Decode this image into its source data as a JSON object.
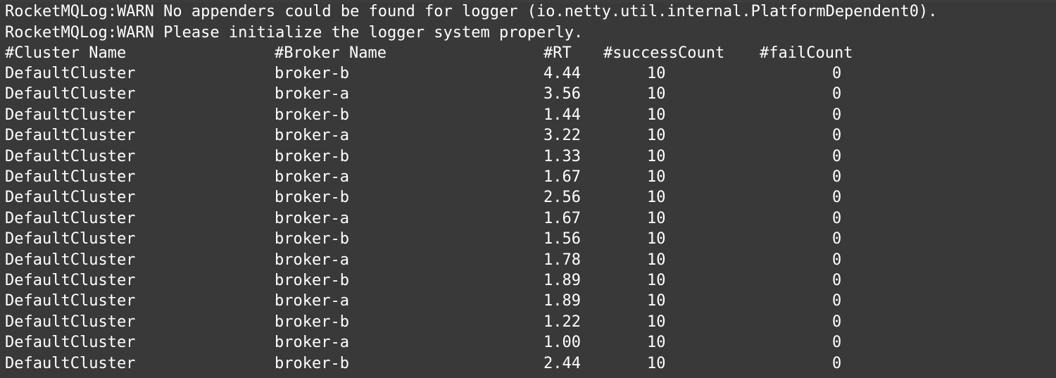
{
  "terminal": {
    "warnings": [
      "RocketMQLog:WARN No appenders could be found for logger (io.netty.util.internal.PlatformDependent0).",
      "RocketMQLog:WARN Please initialize the logger system properly."
    ],
    "headers": {
      "cluster": "#Cluster Name",
      "broker": "#Broker Name",
      "rt": "#RT",
      "success": "#successCount",
      "fail": "#failCount"
    },
    "rows": [
      {
        "cluster": "DefaultCluster",
        "broker": "broker-b",
        "rt": "4.44",
        "success": "10",
        "fail": "0"
      },
      {
        "cluster": "DefaultCluster",
        "broker": "broker-a",
        "rt": "3.56",
        "success": "10",
        "fail": "0"
      },
      {
        "cluster": "DefaultCluster",
        "broker": "broker-b",
        "rt": "1.44",
        "success": "10",
        "fail": "0"
      },
      {
        "cluster": "DefaultCluster",
        "broker": "broker-a",
        "rt": "3.22",
        "success": "10",
        "fail": "0"
      },
      {
        "cluster": "DefaultCluster",
        "broker": "broker-b",
        "rt": "1.33",
        "success": "10",
        "fail": "0"
      },
      {
        "cluster": "DefaultCluster",
        "broker": "broker-a",
        "rt": "1.67",
        "success": "10",
        "fail": "0"
      },
      {
        "cluster": "DefaultCluster",
        "broker": "broker-b",
        "rt": "2.56",
        "success": "10",
        "fail": "0"
      },
      {
        "cluster": "DefaultCluster",
        "broker": "broker-a",
        "rt": "1.67",
        "success": "10",
        "fail": "0"
      },
      {
        "cluster": "DefaultCluster",
        "broker": "broker-b",
        "rt": "1.56",
        "success": "10",
        "fail": "0"
      },
      {
        "cluster": "DefaultCluster",
        "broker": "broker-a",
        "rt": "1.78",
        "success": "10",
        "fail": "0"
      },
      {
        "cluster": "DefaultCluster",
        "broker": "broker-b",
        "rt": "1.89",
        "success": "10",
        "fail": "0"
      },
      {
        "cluster": "DefaultCluster",
        "broker": "broker-a",
        "rt": "1.89",
        "success": "10",
        "fail": "0"
      },
      {
        "cluster": "DefaultCluster",
        "broker": "broker-b",
        "rt": "1.22",
        "success": "10",
        "fail": "0"
      },
      {
        "cluster": "DefaultCluster",
        "broker": "broker-a",
        "rt": "1.00",
        "success": "10",
        "fail": "0"
      },
      {
        "cluster": "DefaultCluster",
        "broker": "broker-b",
        "rt": "2.44",
        "success": "10",
        "fail": "0"
      }
    ]
  },
  "colors": {
    "background": "#393939",
    "foreground": "#ffffff"
  }
}
